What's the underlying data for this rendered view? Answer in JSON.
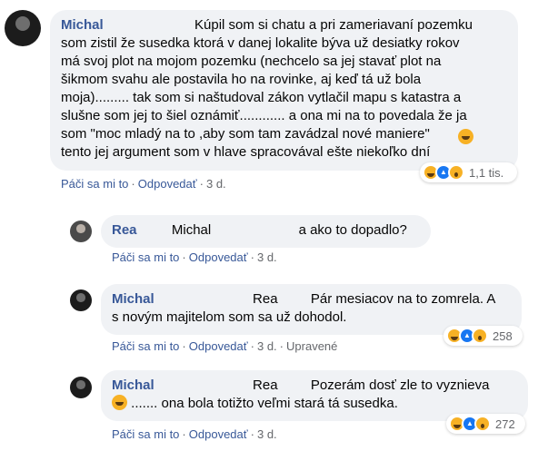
{
  "comments": [
    {
      "author": "Michal",
      "text_line1": "Kúpil som si chatu a pri zameriavaní pozemku",
      "text_rest": "som zistil že susedka ktorá v danej lokalite býva už desiatky rokov\nmá svoj plot na mojom pozemku (nechcelo sa jej stavať plot na\nšikmom svahu ale postavila ho na rovinke, aj keď tá už bola\nmoja)......... tak som si naštudoval zákon vytlačil mapu s katastra a\nslušne som jej to šiel oznámiť............ a ona mi na to povedala že ja\nsom \"moc mladý na to ,aby som tam zavádzal nové maniere\"",
      "text_last": "tento jej argument som v hlave spracovával ešte niekoľko dní",
      "emoji": "grinning-sweat-emoji",
      "actions": {
        "like": "Páči sa mi to",
        "reply": "Odpovedať",
        "time": "3 d."
      },
      "reaction_count": "1,1 tis."
    },
    {
      "author": "Rea",
      "mention": "Michal",
      "text": "a ako to dopadlo?",
      "actions": {
        "like": "Páči sa mi to",
        "reply": "Odpovedať",
        "time": "3 d."
      }
    },
    {
      "author": "Michal",
      "mention": "Rea",
      "text_line1": "Pár mesiacov na to zomrela. A",
      "text_line2": "s novým majitelom som sa už dohodol.",
      "actions": {
        "like": "Páči sa mi to",
        "reply": "Odpovedať",
        "time": "3 d.",
        "edited": "Upravené"
      },
      "reaction_count": "258"
    },
    {
      "author": "Michal",
      "mention": "Rea",
      "text_line1": "Pozerám dosť zle to vyznieva",
      "text_line2": "....... ona bola totižto veľmi stará tá susedka.",
      "emoji": "grinning-sweat-emoji",
      "actions": {
        "like": "Páči sa mi to",
        "reply": "Odpovedať",
        "time": "3 d."
      },
      "reaction_count": "272"
    }
  ],
  "reactions": [
    "haha-reaction-icon",
    "like-reaction-icon",
    "wow-reaction-icon"
  ],
  "colors": {
    "bubble": "#f0f2f5",
    "name": "#385898",
    "meta": "#65676b",
    "like": "#1877f2",
    "haha": "#f7b125"
  }
}
